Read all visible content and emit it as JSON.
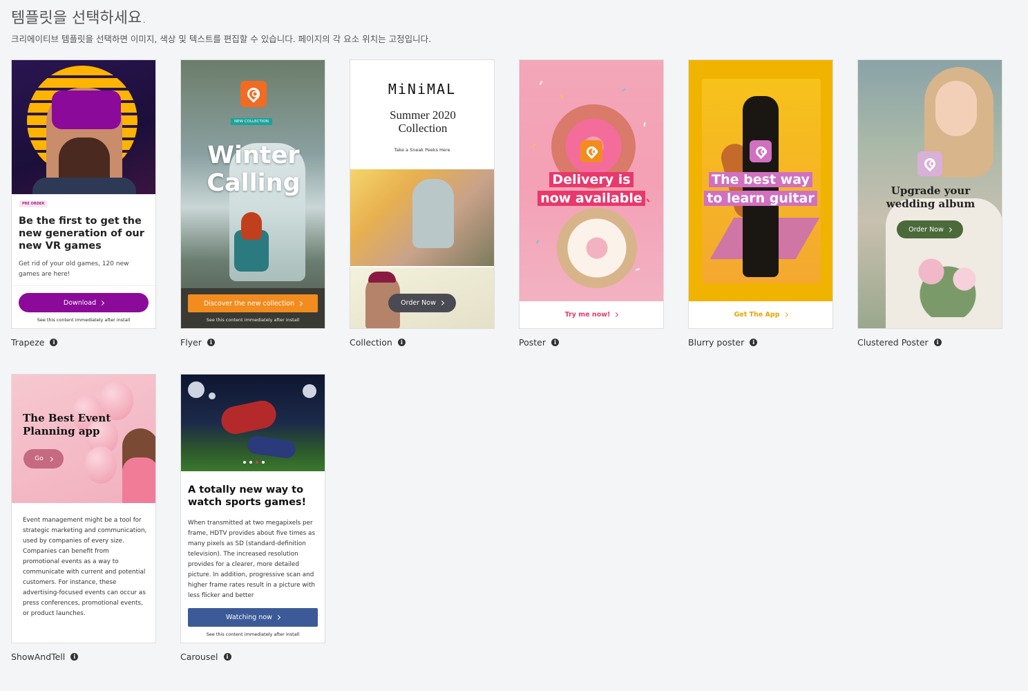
{
  "header": {
    "title": "템플릿을 선택하세요.",
    "description": "크리에이티브 템플릿을 선택하면 이미지, 색상 및 텍스트를 편집할 수 있습니다. 페이지의 각 요소 위치는 고정입니다."
  },
  "info_glyph": "i",
  "templates": {
    "trapeze": {
      "label": "Trapeze",
      "badge": "PRE ORDER",
      "headline": "Be the first to get the new generation of our new VR games",
      "body": "Get rid of your old games, 120 new games are here!",
      "cta": "Download",
      "footer": "See this content immediately after install",
      "accent": "#8b0a9a"
    },
    "flyer": {
      "label": "Flyer",
      "tag": "NEW COLLECTION",
      "headline": "Winter Calling",
      "cta": "Discover the new collection",
      "footer": "See this content immediately after install",
      "accent": "#f28c1e"
    },
    "collection": {
      "label": "Collection",
      "brand": "MiNiMAL",
      "headline": "Summer 2020 Collection",
      "subline": "Take a Sneak Peeks Here",
      "cta": "Order Now"
    },
    "poster": {
      "label": "Poster",
      "headline_line1": "Delivery is",
      "headline_line2": "now available",
      "cta": "Try me now!",
      "accent": "#e8386c"
    },
    "blurry_poster": {
      "label": "Blurry poster",
      "headline_line1": "The best way",
      "headline_line2": "to learn guitar",
      "cta": "Get The App",
      "accent": "#f0b400"
    },
    "clustered_poster": {
      "label": "Clustered Poster",
      "headline": "Upgrade your wedding album",
      "cta": "Order Now",
      "accent": "#4a6a3a"
    },
    "show_and_tell": {
      "label": "ShowAndTell",
      "headline": "The Best Event Planning app",
      "cta": "Go",
      "body": "Event management might be a tool for strategic marketing and communication, used by companies of every size. Companies can benefit from promotional events as a way to communicate with current and potential customers. For instance, these advertising-focused events can occur as press conferences, promotional events, or product launches."
    },
    "carousel": {
      "label": "Carousel",
      "headline": "A totally new way to watch sports games!",
      "body": "When transmitted at two megapixels per frame, HDTV provides about five times as many pixels as SD (standard-definition television). The increased resolution provides for a clearer, more detailed picture. In addition, progressive scan and higher frame rates result in a picture with less flicker and better",
      "cta": "Watching now",
      "footer": "See this content immediately after install",
      "accent": "#3d5a98"
    }
  }
}
